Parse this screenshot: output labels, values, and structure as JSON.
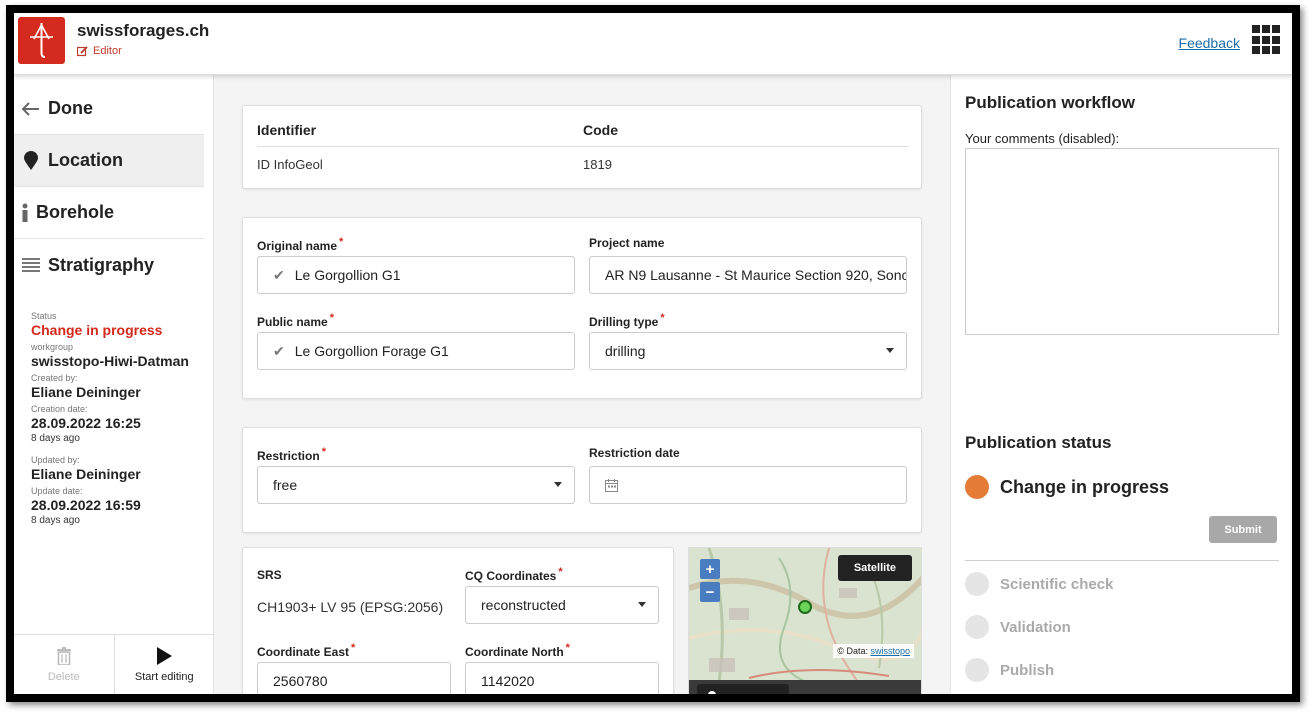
{
  "header": {
    "app_title": "swissforages.ch",
    "mode_label": "Editor",
    "feedback_label": "Feedback",
    "brand_color": "#d42b1e"
  },
  "sidebar": {
    "nav": [
      {
        "label": "Done",
        "icon": "arrow-left-icon"
      },
      {
        "label": "Location",
        "icon": "map-pin-icon"
      },
      {
        "label": "Borehole",
        "icon": "info-icon"
      },
      {
        "label": "Stratigraphy",
        "icon": "list-icon"
      }
    ],
    "meta": {
      "status_label": "Status",
      "status_value": "Change in progress",
      "workgroup_label": "workgroup",
      "workgroup_value": "swisstopo-Hiwi-Datman",
      "created_by_label": "Created by:",
      "created_by_value": "Eliane Deininger",
      "creation_date_label": "Creation date:",
      "creation_date_value": "28.09.2022 16:25",
      "creation_ago": "8 days ago",
      "updated_by_label": "Updated by:",
      "updated_by_value": "Eliane Deininger",
      "update_date_label": "Update date:",
      "update_date_value": "28.09.2022 16:59",
      "update_ago": "8 days ago"
    },
    "footer": {
      "delete_label": "Delete",
      "start_editing_label": "Start editing"
    }
  },
  "main": {
    "identifier_table": {
      "headers": [
        "Identifier",
        "Code"
      ],
      "rows": [
        [
          "ID InfoGeol",
          "1819"
        ]
      ]
    },
    "names": {
      "original_name_label": "Original name",
      "original_name_value": "Le Gorgollion G1",
      "project_name_label": "Project name",
      "project_name_value": "AR N9 Lausanne - St Maurice Section 920, Sonc",
      "public_name_label": "Public name",
      "public_name_value": "Le Gorgollion Forage G1",
      "drilling_type_label": "Drilling type",
      "drilling_type_value": "drilling"
    },
    "restriction": {
      "restriction_label": "Restriction",
      "restriction_value": "free",
      "restriction_date_label": "Restriction date"
    },
    "coordinates": {
      "srs_label": "SRS",
      "srs_value": "CH1903+ LV 95 (EPSG:2056)",
      "cq_label": "CQ Coordinates",
      "cq_value": "reconstructed",
      "east_label": "Coordinate East",
      "east_value": "2560780",
      "north_label": "Coordinate North",
      "north_value": "1142020"
    },
    "map": {
      "satellite_label": "Satellite",
      "zoom_in": "+",
      "zoom_out": "−",
      "attribution_prefix": "© Data:",
      "attribution_link": "swisstopo"
    }
  },
  "right_panel": {
    "workflow_title": "Publication workflow",
    "comments_label": "Your comments (disabled):",
    "status_title": "Publication status",
    "current_status": "Change in progress",
    "current_color": "#e47c37",
    "submit_label": "Submit",
    "steps": [
      "Scientific check",
      "Validation",
      "Publish"
    ]
  }
}
